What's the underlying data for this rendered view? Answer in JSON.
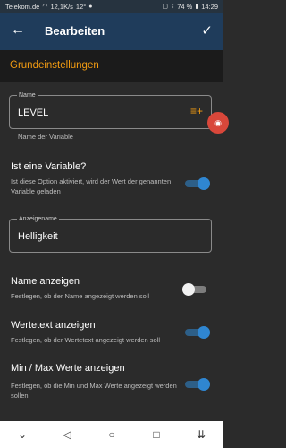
{
  "status_bar": {
    "carrier": "Telekom.de",
    "speed": "12,1K/s",
    "temp": "12°",
    "battery": "74 %",
    "time": "14:29"
  },
  "app_bar": {
    "title": "Bearbeiten",
    "back_icon": "arrow-left-icon",
    "confirm_icon": "check-icon"
  },
  "section": {
    "title": "Grundeinstellungen"
  },
  "name_field": {
    "legend": "Name",
    "value": "LEVEL",
    "helper": "Name der Variable",
    "side_icon": "playlist-add-icon"
  },
  "settings": [
    {
      "title": "Ist eine Variable?",
      "desc": "Ist diese Option aktiviert, wird der Wert der genannten Variable geladen",
      "on": true
    },
    {
      "title": "Name anzeigen",
      "desc": "Festlegen, ob der Name angezeigt werden soll",
      "on": false
    },
    {
      "title": "Wertetext anzeigen",
      "desc": "Festlegen, ob der Wertetext angezeigt werden soll",
      "on": true
    },
    {
      "title": "Min / Max Werte anzeigen",
      "desc": "Festlegen, ob die Min und Max Werte angezeigt werden sollen",
      "on": true
    }
  ],
  "display_name_field": {
    "legend": "Anzeigename",
    "value": "Helligkeit"
  },
  "colors": {
    "app_bar": "#1f3c5b",
    "accent_orange": "#f39c12",
    "toggle_on": "#2f86d1",
    "background": "#2b2b2b"
  }
}
